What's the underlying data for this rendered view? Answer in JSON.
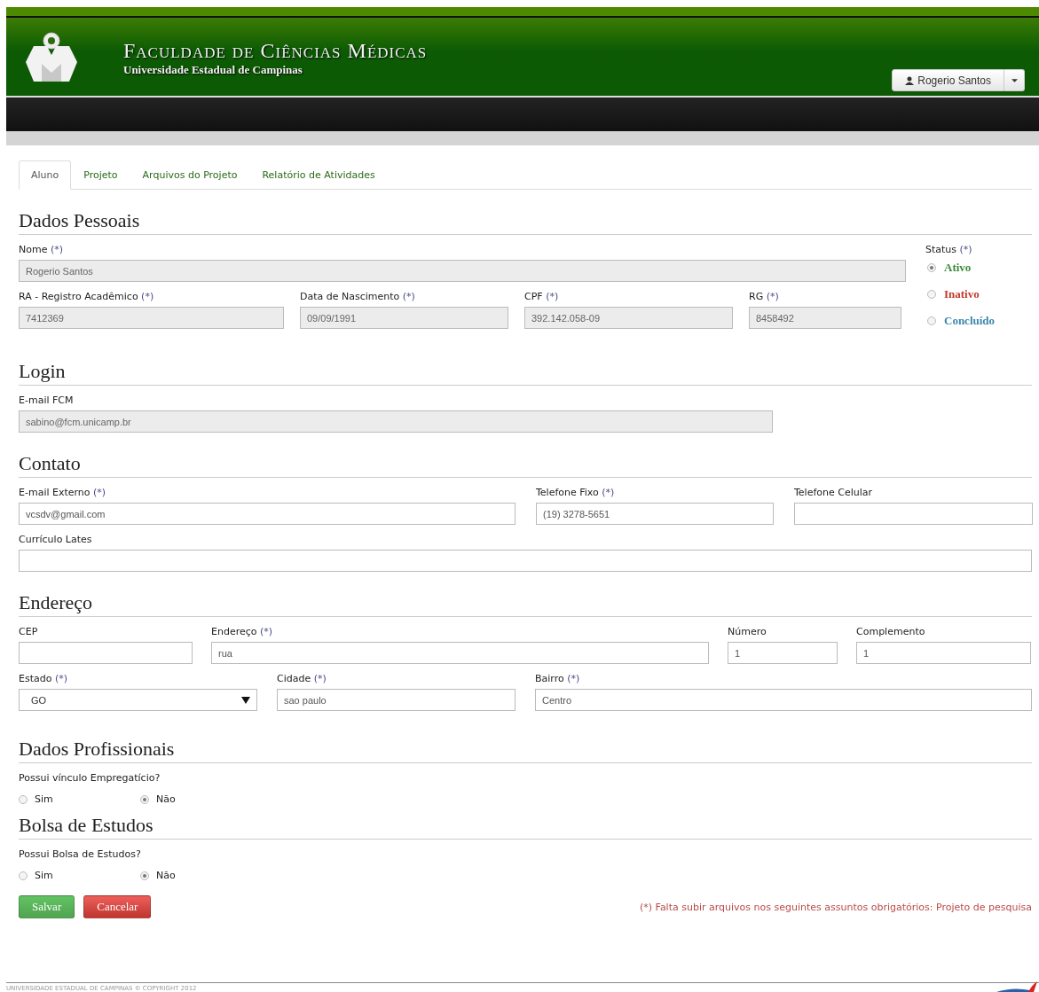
{
  "header": {
    "title": "Faculdade de Ciências Médicas",
    "subtitle": "Universidade Estadual de Campinas",
    "user_button": "Rogerio Santos"
  },
  "tabs": [
    {
      "label": "Aluno",
      "selected": true
    },
    {
      "label": "Projeto",
      "selected": false
    },
    {
      "label": "Arquivos do Projeto",
      "selected": false
    },
    {
      "label": "Relatório de Atividades",
      "selected": false
    }
  ],
  "dados_pessoais": {
    "heading": "Dados Pessoais",
    "nome": {
      "label": "Nome",
      "required": "(*)",
      "value": "Rogerio Santos"
    },
    "fields": [
      {
        "label": "RA - Registro Acadêmico",
        "required": "(*)",
        "value": "7412369"
      },
      {
        "label": "Data de Nascimento",
        "required": "(*)",
        "value": "09/09/1991"
      },
      {
        "label": "CPF",
        "required": "(*)",
        "value": "392.142.058-09"
      },
      {
        "label": "RG",
        "required": "(*)",
        "value": "8458492"
      }
    ],
    "status": {
      "label": "Status",
      "required": "(*)",
      "options": [
        {
          "label": "Ativo",
          "selected": true,
          "color": "#3c8a3c"
        },
        {
          "label": "Inativo",
          "selected": false,
          "color": "#c0392b"
        },
        {
          "label": "Concluído",
          "selected": false,
          "color": "#3a87ad"
        }
      ]
    }
  },
  "login": {
    "heading": "Login",
    "email": {
      "label": "E-mail FCM",
      "value": "sabino@fcm.unicamp.br"
    }
  },
  "contato": {
    "heading": "Contato",
    "fields": [
      {
        "label": "E-mail Externo",
        "required": "(*)",
        "value": "vcsdv@gmail.com"
      },
      {
        "label": "Telefone Fixo",
        "required": "(*)",
        "value": "(19) 3278-5651"
      },
      {
        "label": "Telefone Celular"
      }
    ],
    "curriculo": {
      "label": "Currículo Lates"
    }
  },
  "endereco": {
    "heading": "Endereço",
    "row1": [
      {
        "label": "CEP"
      },
      {
        "label": "Endereço",
        "required": "(*)",
        "value": "rua"
      },
      {
        "label": "Número",
        "value": "1"
      },
      {
        "label": "Complemento",
        "value": "1"
      }
    ],
    "row2": [
      {
        "label": "Estado",
        "required": "(*)",
        "value": "GO",
        "kind": "select"
      },
      {
        "label": "Cidade",
        "required": "(*)",
        "value": "sao paulo",
        "kind": "text"
      },
      {
        "label": "Bairro",
        "required": "(*)",
        "value": "Centro",
        "kind": "text"
      }
    ]
  },
  "dados_profissionais": {
    "heading": "Dados Profissionais",
    "question": "Possui vínculo Empregatício?",
    "options": [
      {
        "label": "Sim",
        "selected": false
      },
      {
        "label": "Não",
        "selected": true
      }
    ]
  },
  "bolsa": {
    "heading": "Bolsa de Estudos",
    "question": "Possui Bolsa de Estudos?",
    "options": [
      {
        "label": "Sim",
        "selected": false
      },
      {
        "label": "Não",
        "selected": true
      }
    ]
  },
  "buttons": {
    "save": "Salvar",
    "cancel": "Cancelar"
  },
  "warning": {
    "required": "(*)",
    "text": "Falta subir arquivos nos seguintes assuntos obrigatórios: Projeto de pesquisa"
  },
  "footer": "UNIVERSIDADE ESTADUAL DE CAMPINAS © COPYRIGHT 2012"
}
